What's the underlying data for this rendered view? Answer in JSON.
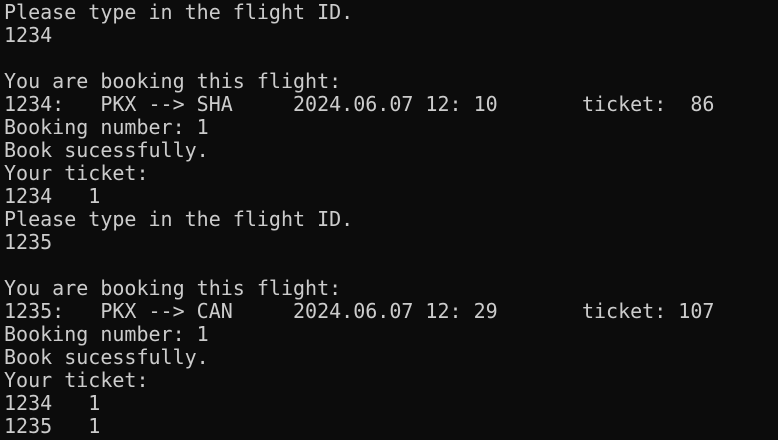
{
  "terminal": {
    "lines": [
      "Please type in the flight ID.",
      "1234",
      "",
      "You are booking this flight:",
      "1234:   PKX --> SHA     2024.06.07 12: 10       ticket:  86",
      "Booking number: 1",
      "Book sucessfully.",
      "Your ticket:",
      "1234   1",
      "Please type in the flight ID.",
      "1235",
      "",
      "You are booking this flight:",
      "1235:   PKX --> CAN     2024.06.07 12: 29       ticket: 107",
      "Booking number: 1",
      "Book sucessfully.",
      "Your ticket:",
      "1234   1",
      "1235   1"
    ]
  },
  "colors": {
    "background": "#0c0c0c",
    "text": "#cccccc"
  }
}
